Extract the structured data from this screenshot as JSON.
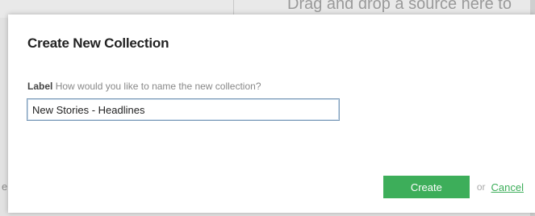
{
  "background": {
    "hint_text": "Drag and drop a source here to",
    "edge_text": "e"
  },
  "dialog": {
    "title": "Create New Collection",
    "label": "Label",
    "hint": "How would you like to name the new collection?",
    "input_value": "New Stories - Headlines",
    "create_label": "Create",
    "or_text": "or",
    "cancel_label": "Cancel"
  },
  "colors": {
    "accent": "#3dae5a",
    "title_text": "#222222",
    "hint_text": "#888888"
  }
}
